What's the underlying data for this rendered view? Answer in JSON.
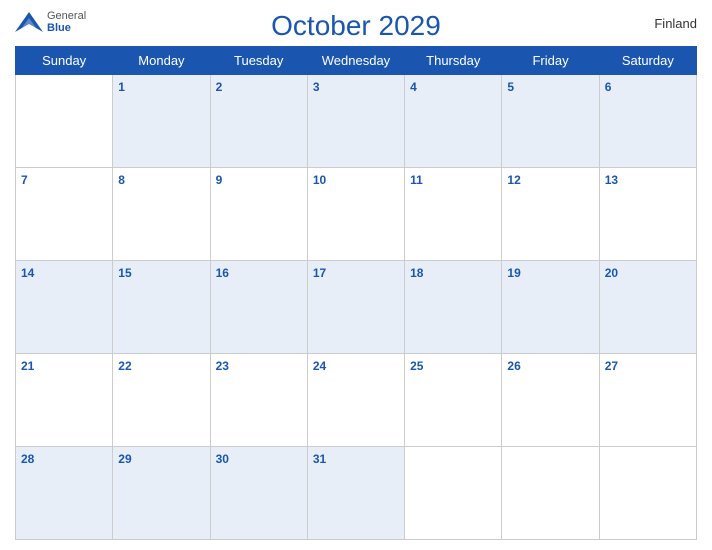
{
  "header": {
    "logo_general": "General",
    "logo_blue": "Blue",
    "title": "October 2029",
    "country": "Finland"
  },
  "calendar": {
    "days_of_week": [
      "Sunday",
      "Monday",
      "Tuesday",
      "Wednesday",
      "Thursday",
      "Friday",
      "Saturday"
    ],
    "weeks": [
      [
        null,
        1,
        2,
        3,
        4,
        5,
        6
      ],
      [
        7,
        8,
        9,
        10,
        11,
        12,
        13
      ],
      [
        14,
        15,
        16,
        17,
        18,
        19,
        20
      ],
      [
        21,
        22,
        23,
        24,
        25,
        26,
        27
      ],
      [
        28,
        29,
        30,
        31,
        null,
        null,
        null
      ]
    ]
  }
}
